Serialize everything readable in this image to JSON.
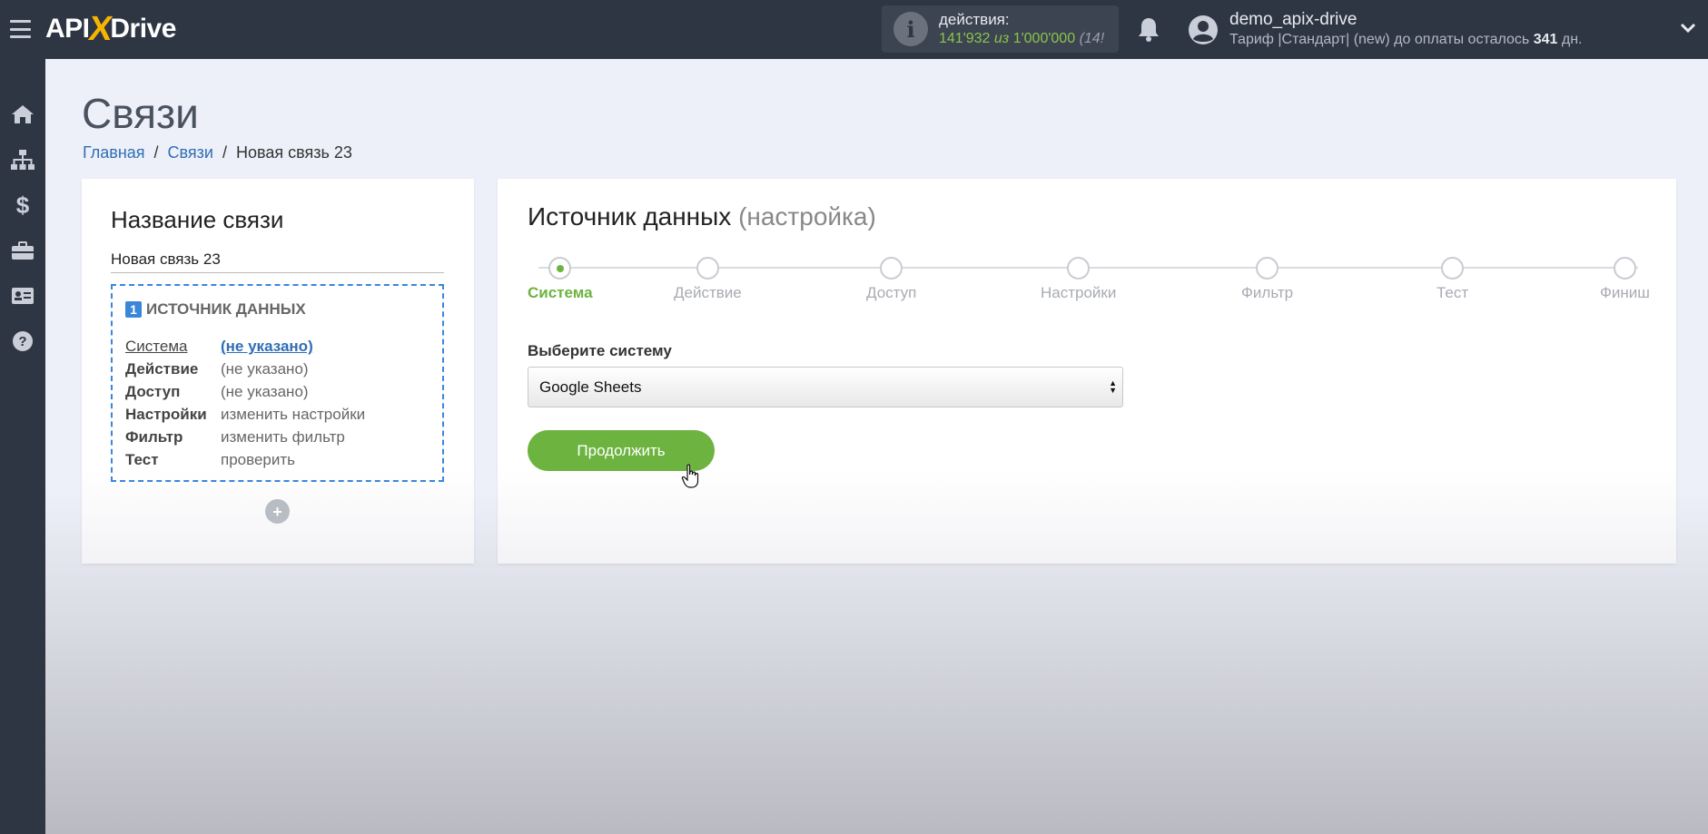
{
  "brand": {
    "logo_left": "API",
    "logo_x": "X",
    "logo_right": "Drive"
  },
  "header": {
    "actions_label": "действия:",
    "actions_used": "141'932",
    "actions_sep": "из",
    "actions_total": "1'000'000",
    "actions_extra": "(14!",
    "user_name": "demo_apix-drive",
    "tariff_prefix": "Тариф |Стандарт| (new) до оплаты осталось",
    "tariff_days": "341",
    "tariff_suffix": "дн."
  },
  "sidebar": {
    "items": [
      {
        "icon": "home-icon"
      },
      {
        "icon": "sitemap-icon"
      },
      {
        "icon": "dollar-icon"
      },
      {
        "icon": "briefcase-icon"
      },
      {
        "icon": "id-card-icon"
      },
      {
        "icon": "help-icon"
      }
    ]
  },
  "page": {
    "title": "Связи",
    "breadcrumb": [
      "Главная",
      "Связи",
      "Новая связь 23"
    ]
  },
  "left_card": {
    "title": "Название связи",
    "name_value": "Новая связь 23",
    "source_num": "1",
    "source_title": "ИСТОЧНИК ДАННЫХ",
    "rows": [
      {
        "key": "Система",
        "value": "(не указано)"
      },
      {
        "key": "Действие",
        "value": "(не указано)"
      },
      {
        "key": "Доступ",
        "value": "(не указано)"
      },
      {
        "key": "Настройки",
        "value": "изменить настройки"
      },
      {
        "key": "Фильтр",
        "value": "изменить фильтр"
      },
      {
        "key": "Тест",
        "value": "проверить"
      }
    ],
    "add_label": "+"
  },
  "right_card": {
    "title": "Источник данных",
    "title_suffix": "(настройка)",
    "steps": [
      "Система",
      "Действие",
      "Доступ",
      "Настройки",
      "Фильтр",
      "Тест",
      "Финиш"
    ],
    "active_step": 0,
    "select_label": "Выберите систему",
    "select_value": "Google Sheets",
    "continue_label": "Продолжить"
  },
  "colors": {
    "topbar": "#2e3644",
    "accent_green": "#6db33f",
    "accent_blue": "#3b86d9",
    "logo_x": "#f7b500"
  }
}
